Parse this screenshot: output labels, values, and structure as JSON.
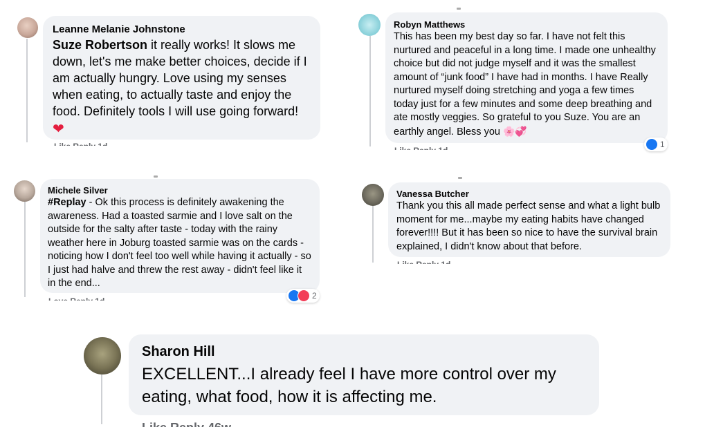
{
  "comments": [
    {
      "author": "Leanne Melanie Johnstone",
      "mention": "Suze Robertson",
      "text": " it really works! It slows me down, let's me make better choices, decide if I am actually hungry. Love using my senses when eating, to actually taste and enjoy the food. Definitely tools I will use going forward!",
      "emoji": "❤️",
      "avatar_color": "#c9a89a"
    },
    {
      "author": "Robyn Matthews",
      "text": "This has been my best day so far. I have not felt this nurtured and peaceful in a long time. I made one unhealthy choice but did not judge myself and it was the smallest amount of “junk food” I have had in months. I have Really nurtured myself doing stretching and yoga a few times today just for a few minutes and some deep breathing and ate mostly veggies. So grateful to you Suze. You are an earthly angel. Bless you",
      "emoji": "🌸💞",
      "reaction_count": "1",
      "avatar_color": "#8fd3dc"
    },
    {
      "author": "Michele Silver",
      "hashtag": "#Replay",
      "text": " - Ok this process is definitely awakening the awareness. Had a toasted sarmie and I love salt on the outside for the salty after taste - today with the rainy weather here in Joburg toasted sarmie was on the cards - noticing how I don't feel too well while having it actually - so I just had halve and threw the rest away - didn't feel like it in the end...",
      "reaction_count": "2",
      "avatar_color": "#b7a79b"
    },
    {
      "author": "Vanessa Butcher",
      "text": "Thank you this all made perfect sense and what a light bulb moment for me...maybe my eating habits have changed forever!!!! But it has been so nice to have the survival brain explained, I didn't know about that before.",
      "avatar_color": "#6d6a5e"
    },
    {
      "author": "Sharon Hill",
      "text": "EXCELLENT...I already feel I have more control over my eating, what food, how it is affecting me.",
      "avatar_color": "#7a7456"
    }
  ],
  "icons": {
    "like": "like-icon",
    "love": "love-icon"
  },
  "colors": {
    "bubble": "#f0f2f5",
    "like": "#1877f2",
    "love": "#f33e58",
    "heart": "#e41e3f"
  }
}
